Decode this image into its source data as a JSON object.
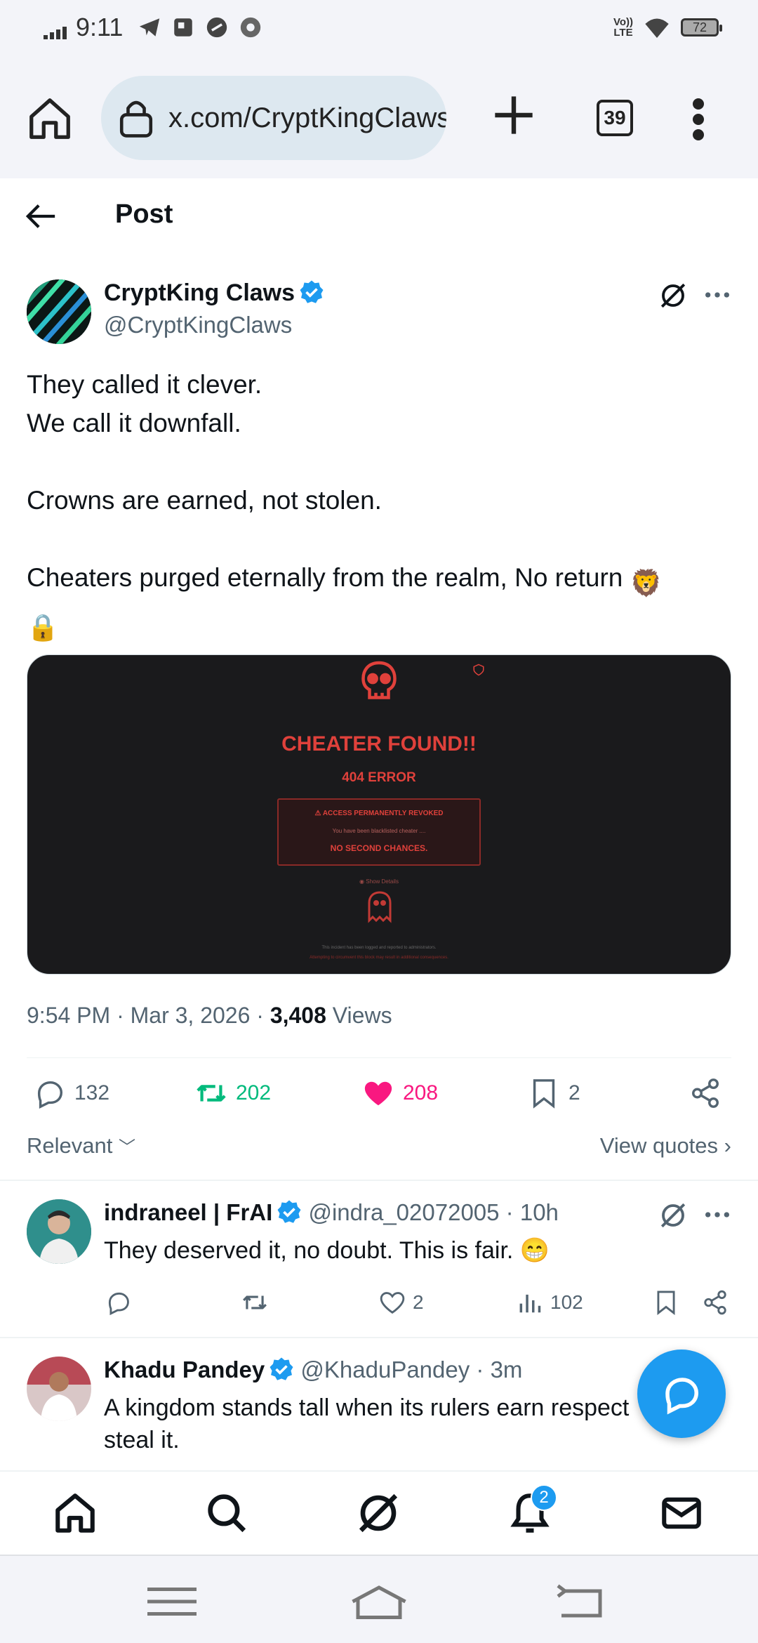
{
  "status_bar": {
    "time": "9:11",
    "network": "Vo)) LTE",
    "battery": "72"
  },
  "browser": {
    "url": "x.com/CryptKingClaws",
    "tab_count": "39"
  },
  "header": {
    "title": "Post"
  },
  "post": {
    "author_name": "CryptKing Claws",
    "author_handle": "@CryptKingClaws",
    "lines": [
      "They called it clever.",
      "We call it downfall.",
      "",
      "Crowns are earned, not stolen.",
      "",
      "Cheaters purged eternally from the realm, No return"
    ],
    "trailing_emoji": "🦁",
    "last_emoji": "🔒",
    "media": {
      "title": "CHEATER FOUND!!",
      "subtitle": "404 ERROR",
      "box_line1": "ACCESS PERMANENTLY REVOKED",
      "box_line2": "You have been blacklisted cheater ....",
      "box_line3": "NO SECOND CHANCES.",
      "details": "Show Details",
      "footer1": "This incident has been logged and reported to administrators.",
      "footer2": "Attempting to circumvent this block may result in additional consequences."
    },
    "time": "9:54 PM",
    "date": "Mar 3, 2026",
    "views_count": "3,408",
    "views_label": "Views",
    "replies": "132",
    "reposts": "202",
    "likes": "208",
    "bookmarks": "2"
  },
  "sort": {
    "left": "Relevant",
    "right": "View quotes"
  },
  "replies": [
    {
      "name": "indraneel | FrAI",
      "handle": "@indra_02072005",
      "time": "10h",
      "text": "They deserved it, no doubt. This is fair. 😁",
      "likes": "2",
      "views": "102"
    },
    {
      "name": "Khadu Pandey",
      "handle": "@KhaduPandey",
      "time": "3m",
      "text": "A kingdom stands tall when its rulers earn respect steal it."
    }
  ],
  "tabbar": {
    "notifications_badge": "2"
  },
  "colors": {
    "accent": "#1d9bf0",
    "repost": "#00ba7c",
    "like": "#f91880",
    "muted": "#536471",
    "cheater_red": "#e0413b"
  }
}
